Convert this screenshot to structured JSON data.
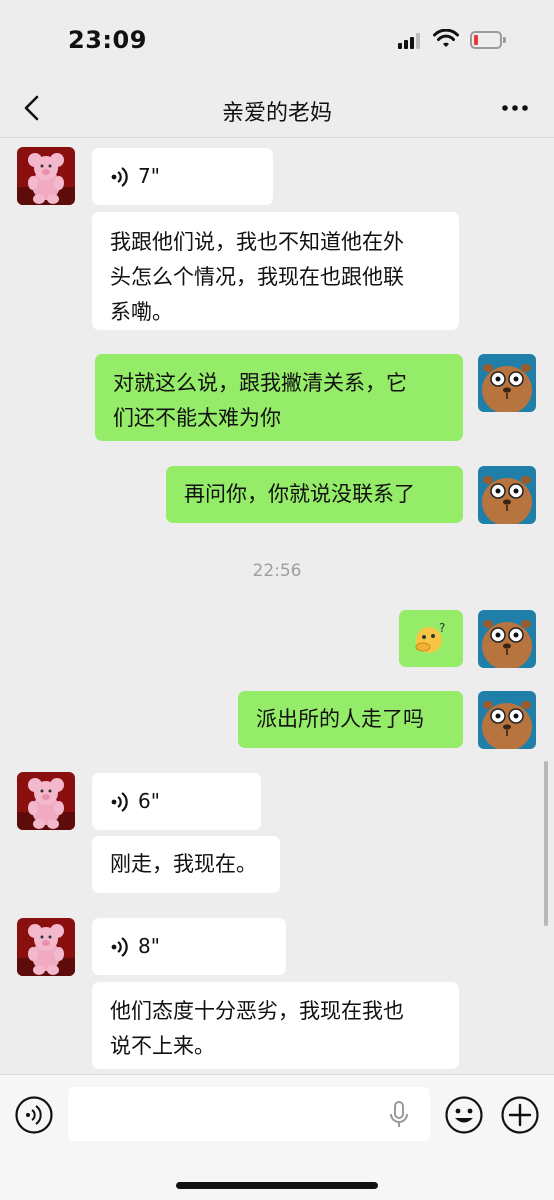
{
  "status_bar": {
    "time": "23:09",
    "icons": [
      "signal-icon",
      "wifi-icon",
      "battery-low-icon"
    ]
  },
  "header": {
    "title": "亲爱的老妈",
    "back_icon": "chevron-left-icon",
    "more_icon": "more-dots-icon"
  },
  "messages": [
    {
      "sender": "contact",
      "type": "voice",
      "duration": "7\""
    },
    {
      "sender": "contact",
      "type": "text",
      "lines": [
        "我跟他们说，我也不知道他在外",
        "头怎么个情况，我现在也跟他联",
        "系嘞。"
      ]
    },
    {
      "sender": "me",
      "type": "text",
      "lines": [
        "对就这么说，跟我撇清关系，它",
        "们还不能太难为你"
      ]
    },
    {
      "sender": "me",
      "type": "text",
      "lines": [
        "再问你，你就说没联系了"
      ]
    },
    {
      "type": "time",
      "text": "22:56"
    },
    {
      "sender": "me",
      "type": "sticker",
      "emoji": "🫣"
    },
    {
      "sender": "me",
      "type": "text",
      "lines": [
        "派出所的人走了吗"
      ]
    },
    {
      "sender": "contact",
      "type": "voice",
      "duration": "6\""
    },
    {
      "sender": "contact",
      "type": "text",
      "lines": [
        "刚走，我现在。"
      ]
    },
    {
      "sender": "contact",
      "type": "voice",
      "duration": "8\""
    },
    {
      "sender": "contact",
      "type": "text",
      "lines": [
        "他们态度十分恶劣，我现在我也",
        "说不上来。"
      ]
    }
  ],
  "avatars": {
    "contact": "pink-teddy-bear-avatar",
    "me": "capybara-cartoon-avatar"
  },
  "input_bar": {
    "value": "",
    "placeholder": "",
    "icons": [
      "voice-toggle-icon",
      "microphone-icon",
      "emoji-icon",
      "plus-icon"
    ]
  },
  "colors": {
    "background": "#ededed",
    "bubble_in": "#ffffff",
    "bubble_out": "#95ec69",
    "timestamp": "#9e9e9e"
  }
}
